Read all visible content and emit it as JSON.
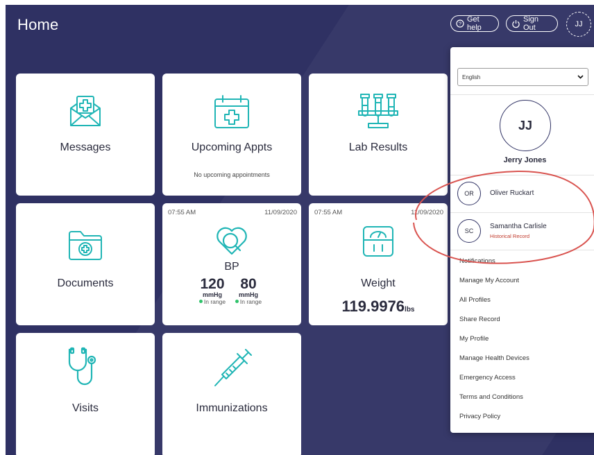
{
  "header": {
    "title": "Home",
    "get_help": "Get help",
    "sign_out": "Sign Out",
    "avatar_initials": "JJ"
  },
  "tiles": {
    "messages": {
      "title": "Messages"
    },
    "upcoming": {
      "title": "Upcoming Appts",
      "subtitle": "No upcoming appointments"
    },
    "lab": {
      "title": "Lab Results"
    },
    "documents": {
      "title": "Documents"
    },
    "bp": {
      "time": "07:55 AM",
      "date": "11/09/2020",
      "title": "BP",
      "systolic": "120",
      "diastolic": "80",
      "unit": "mmHg",
      "status": "In range"
    },
    "weight": {
      "time": "07:55 AM",
      "date": "11/09/2020",
      "title": "Weight",
      "value": "119.9976",
      "unit": "lbs"
    },
    "visits": {
      "title": "Visits"
    },
    "immunizations": {
      "title": "Immunizations"
    }
  },
  "menu": {
    "language": "English",
    "user_initials": "JJ",
    "user_name": "Jerry Jones",
    "profiles": [
      {
        "initials": "OR",
        "name": "Oliver Ruckart",
        "note": ""
      },
      {
        "initials": "SC",
        "name": "Samantha Carlisle",
        "note": "Historical Record"
      }
    ],
    "links": [
      "Notifications",
      "Manage My Account",
      "All Profiles",
      "Share Record",
      "My Profile",
      "Manage Health Devices",
      "Emergency Access",
      "Terms and Conditions",
      "Privacy Policy"
    ]
  },
  "colors": {
    "background": "#2f3163",
    "icon_teal": "#1fb5b5",
    "annotation_red": "#d9534f",
    "status_green": "#2ec26a",
    "note_red": "#c0392b"
  },
  "icons": [
    "help-icon",
    "power-icon",
    "chevron-down-icon",
    "envelope-plus-icon",
    "calendar-plus-icon",
    "test-tubes-icon",
    "folder-plus-icon",
    "heart-search-icon",
    "scale-icon",
    "stethoscope-icon",
    "syringe-icon"
  ]
}
